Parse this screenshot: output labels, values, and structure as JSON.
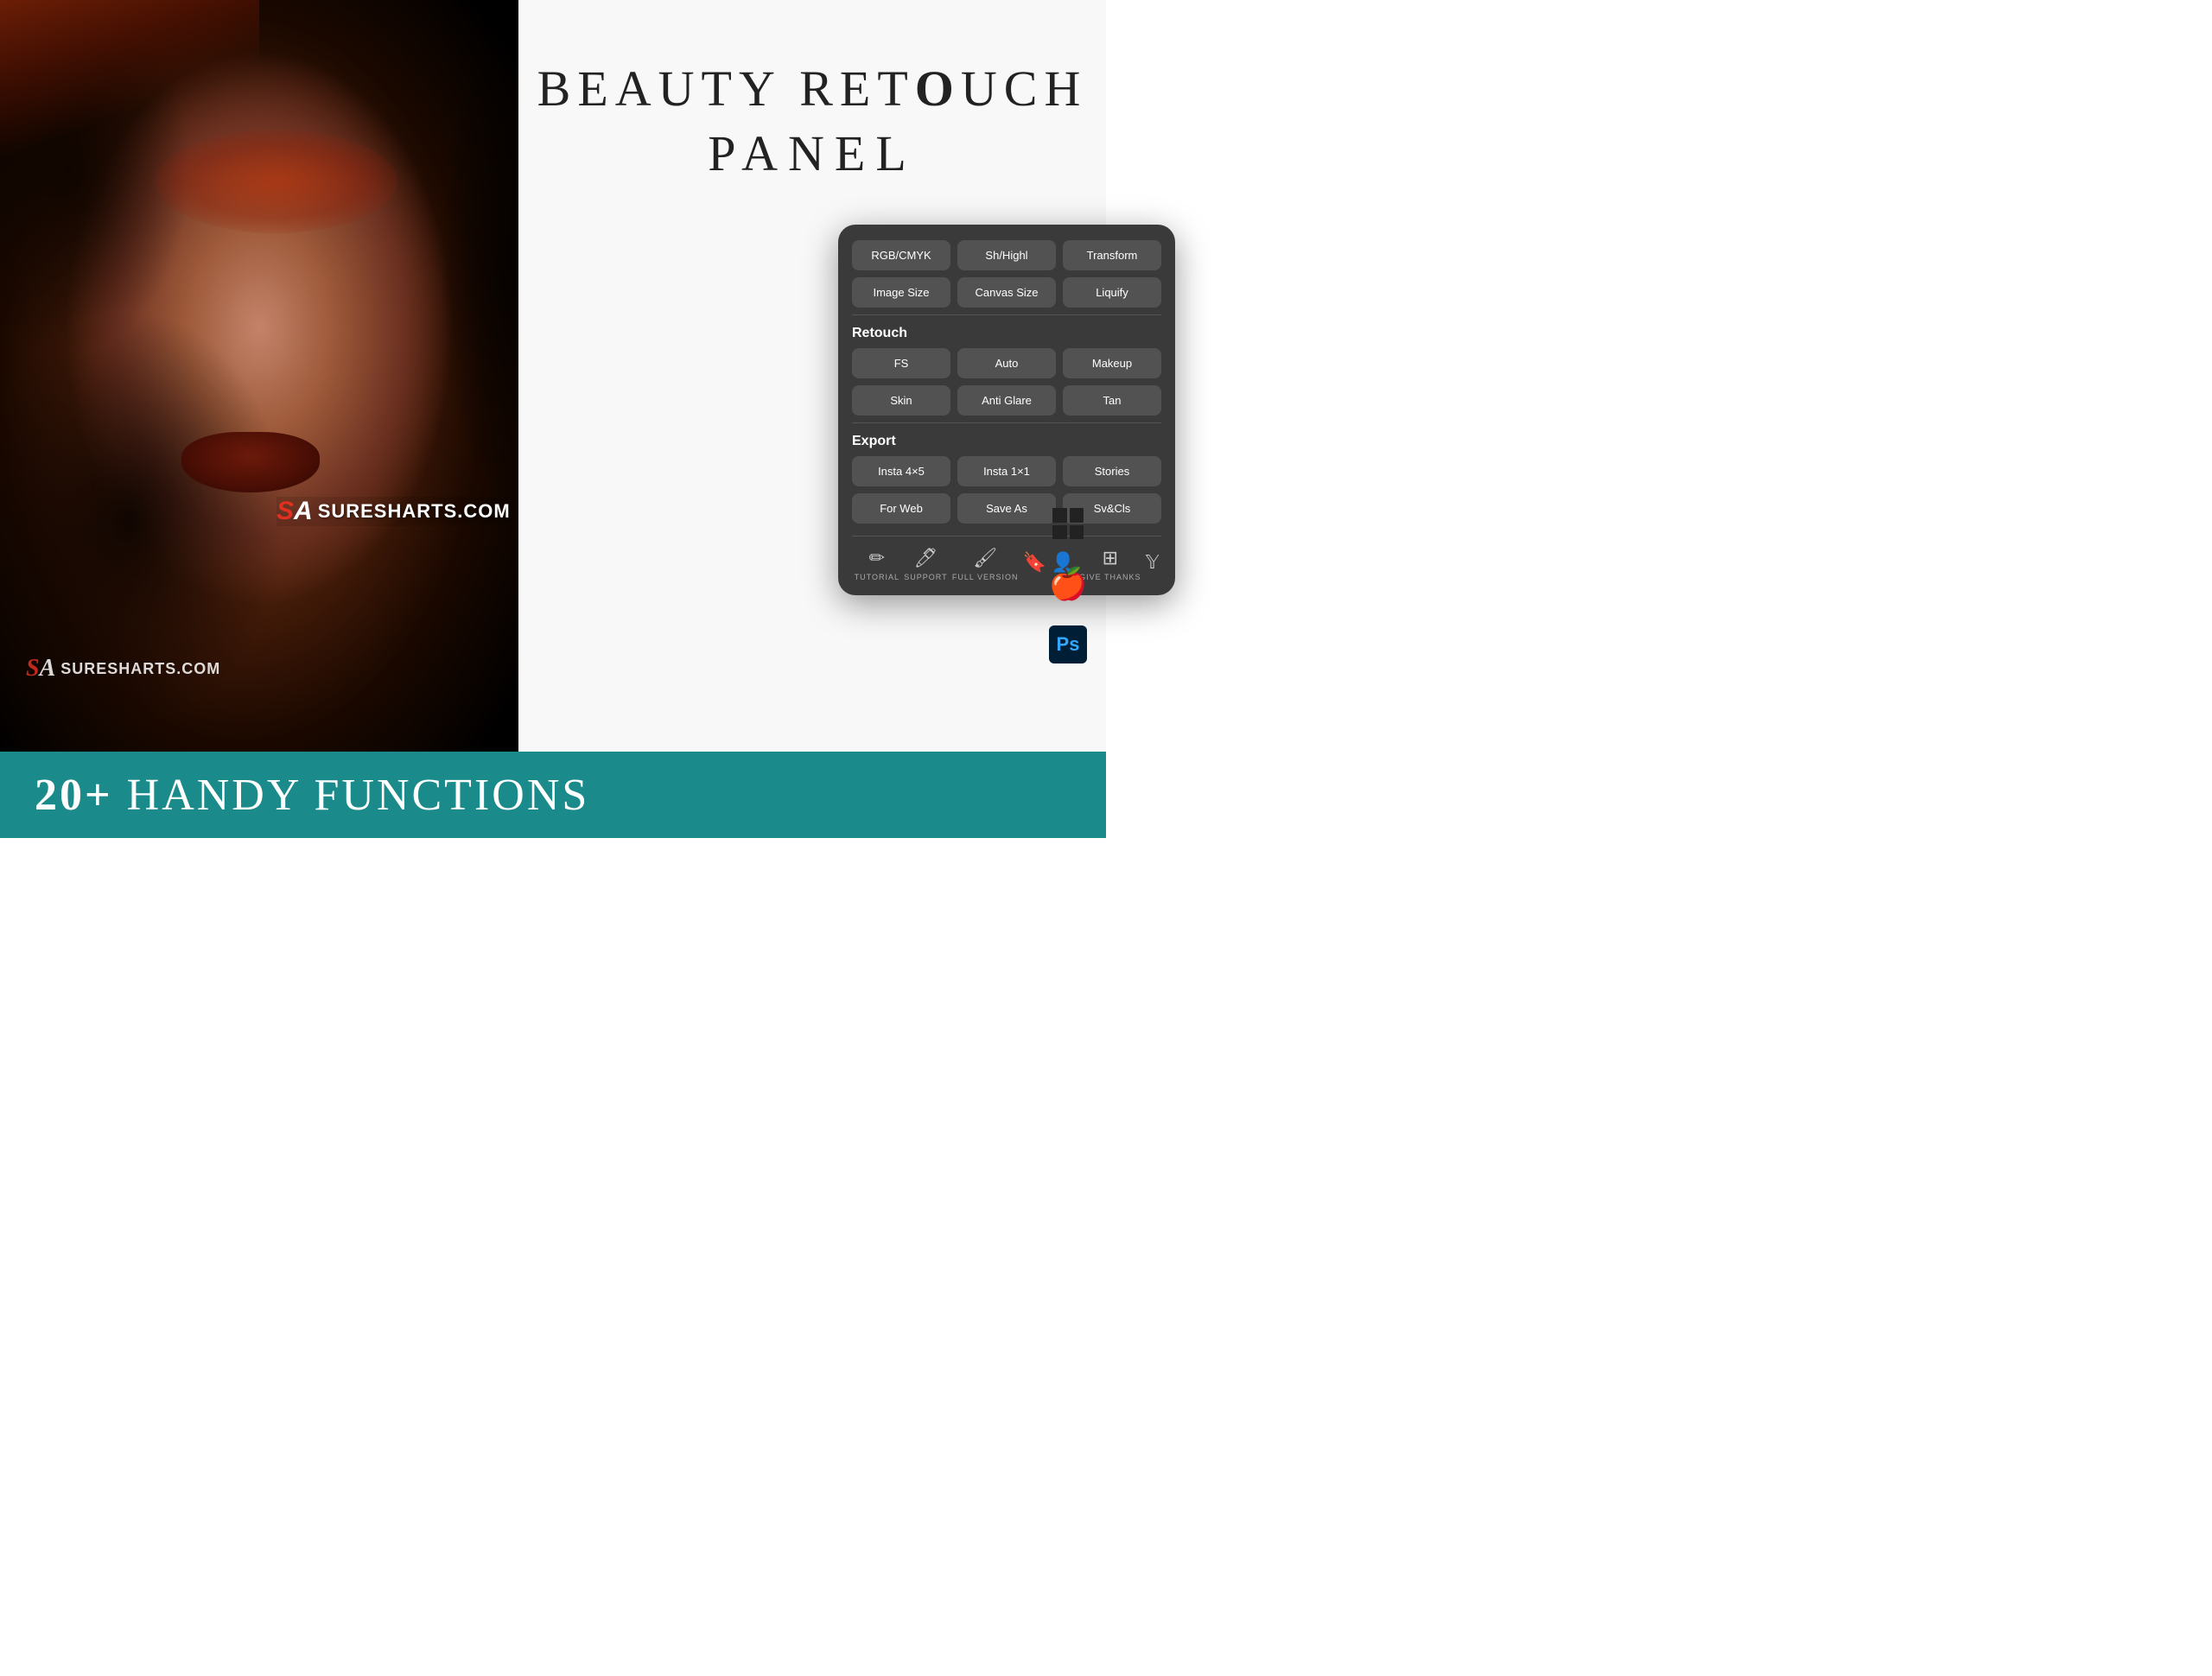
{
  "title": {
    "line1": "BEAUTY RET",
    "line1_bold": "O",
    "line1_end": "UCH",
    "line2": "PANEL"
  },
  "panel": {
    "rows": {
      "row1": [
        "RGB/CMYK",
        "Sh/Highl",
        "Transform"
      ],
      "row2": [
        "Image Size",
        "Canvas Size",
        "Liquify"
      ]
    },
    "retouch": {
      "label": "Retouch",
      "row1": [
        "FS",
        "Auto",
        "Makeup"
      ],
      "row2": [
        "Skin",
        "Anti Glare",
        "Tan"
      ]
    },
    "export": {
      "label": "Export",
      "row1": [
        "Insta 4×5",
        "Insta 1×1",
        "Stories"
      ],
      "row2": [
        "For Web",
        "Save As",
        "Sv&Cls"
      ]
    },
    "toolbar": [
      {
        "icon": "✏️",
        "label": "TUTORIAL"
      },
      {
        "icon": "🖊️",
        "label": "SUPPORT"
      },
      {
        "icon": "🖌️",
        "label": "FULL VERSION"
      },
      {
        "icon": "🔖",
        "label": ""
      },
      {
        "icon": "👤",
        "label": ""
      },
      {
        "icon": "➕",
        "label": "GIVE THANKS"
      },
      {
        "icon": "𝕐",
        "label": ""
      }
    ]
  },
  "bottom_bar": {
    "text_prefix": "20+",
    "text_suffix": " HANDY FUNCTIONS"
  },
  "watermark": {
    "logo_s": "S",
    "logo_a": "A",
    "site": "SURESHARTS.COM"
  },
  "platforms": [
    "windows",
    "apple",
    "photoshop"
  ]
}
